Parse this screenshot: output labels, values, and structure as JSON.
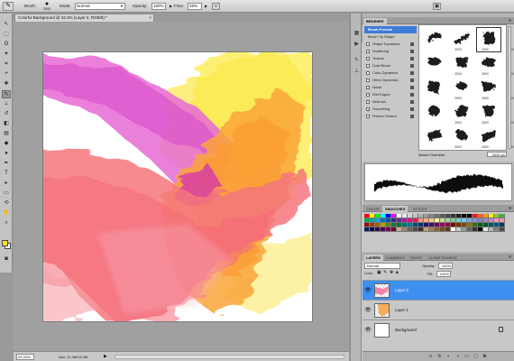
{
  "options_bar": {
    "brush_label": "Brush:",
    "brush_size": "2000",
    "mode_label": "Mode:",
    "mode_value": "Normal",
    "opacity_label": "Opacity:",
    "opacity_value": "100%",
    "flow_label": "Flow:",
    "flow_value": "49%"
  },
  "document": {
    "title": "Colorful Background @ 33.3% (Layer 2, RGB/8) *",
    "close": "×",
    "zoom": "33.33%",
    "doc_size": "Doc: 11.4M/15.0M"
  },
  "brushes_panel": {
    "tab": "BRUSHES",
    "presets_label": "Brush Presets",
    "options": [
      {
        "label": "Brush Tip Shape",
        "checkbox": false
      },
      {
        "label": "Shape Dynamics",
        "checkbox": true,
        "checked": false
      },
      {
        "label": "Scattering",
        "checkbox": true,
        "checked": false
      },
      {
        "label": "Texture",
        "checkbox": true,
        "checked": false
      },
      {
        "label": "Dual Brush",
        "checkbox": true,
        "checked": false
      },
      {
        "label": "Color Dynamics",
        "checkbox": true,
        "checked": false
      },
      {
        "label": "Other Dynamics",
        "checkbox": true,
        "checked": false
      },
      {
        "label": "Noise",
        "checkbox": true,
        "checked": false
      },
      {
        "label": "Wet Edges",
        "checkbox": true,
        "checked": false
      },
      {
        "label": "Airbrush",
        "checkbox": true,
        "checked": false
      },
      {
        "label": "Smoothing",
        "checkbox": true,
        "checked": true
      },
      {
        "label": "Protect Texture",
        "checkbox": true,
        "checked": false
      }
    ],
    "preset_sizes": [
      "2000",
      "2000",
      "2500",
      "2500",
      "2500",
      "2500",
      "2500",
      "2500",
      "2500",
      "2500",
      "2500",
      "2500",
      "2500",
      "2500",
      "2500"
    ],
    "master_diameter_label": "Master Diameter",
    "master_diameter_value": "2000 px"
  },
  "swatches_panel": {
    "tabs": [
      "COLOR",
      "SWATCHES",
      "STYLES"
    ],
    "active_tab": "SWATCHES",
    "colors": [
      "#ff0000",
      "#ffff00",
      "#00ff00",
      "#00ffff",
      "#0000ff",
      "#ff00ff",
      "#ffffff",
      "#ebebeb",
      "#d6d6d6",
      "#c2c2c2",
      "#adadad",
      "#999999",
      "#858585",
      "#707070",
      "#5c5c5c",
      "#474747",
      "#333333",
      "#1f1f1f",
      "#0a0a0a",
      "#000000",
      "#ed1c24",
      "#f26522",
      "#f7941d",
      "#fff200",
      "#8dc63f",
      "#39b54a",
      "#00a651",
      "#00a99d",
      "#00aeef",
      "#0072bc",
      "#0054a6",
      "#2e3192",
      "#662d91",
      "#92278f",
      "#ec008c",
      "#ed145b",
      "#f69679",
      "#f9ad81",
      "#fdc68a",
      "#fff79a",
      "#c4df9b",
      "#a3d39c",
      "#82ca9c",
      "#7accc8",
      "#6dcff6",
      "#7da7d9",
      "#8393ca",
      "#8781bd",
      "#a186be",
      "#bd8cbf",
      "#f49ac2",
      "#f6989d",
      "#9e0b0f",
      "#a0410d",
      "#a36209",
      "#aba000",
      "#598527",
      "#1a7b30",
      "#007236",
      "#00746b",
      "#0076a3",
      "#004b80",
      "#003471",
      "#1b1464",
      "#440e62",
      "#630460",
      "#9e005d",
      "#9e0039",
      "#790000",
      "#7b2e00",
      "#7d4900",
      "#827b00",
      "#406618",
      "#005e20",
      "#005826",
      "#005952",
      "#005b7f",
      "#003663",
      "#002157",
      "#0d004c",
      "#32004b",
      "#4b0049",
      "#7b0046",
      "#7a0026",
      "#c7b299",
      "#998675",
      "#736357",
      "#534741",
      "#37302d",
      "#c69c6d",
      "#a67c52",
      "#8c6239",
      "#754c24",
      "#603913",
      "#ffffff",
      "#cccccc",
      "#999999",
      "#666666",
      "#333333",
      "#000000",
      "#e6e6e6",
      "#b3b3b3",
      "#808080",
      "#4d4d4d"
    ]
  },
  "layers_panel": {
    "tabs": [
      "LAYERS",
      "CHANNELS",
      "PATHS",
      "CLONE SOURCE"
    ],
    "active_tab": "LAYERS",
    "blend_mode": "Normal",
    "opacity_label": "Opacity:",
    "opacity_value": "100%",
    "lock_label": "Lock:",
    "fill_label": "Fill:",
    "fill_value": "100%",
    "layers": [
      {
        "name": "Layer 2",
        "selected": true,
        "thumb": "pink-strokes"
      },
      {
        "name": "Layer 1",
        "selected": false,
        "thumb": "orange-strokes"
      },
      {
        "name": "Background",
        "selected": false,
        "thumb": "white",
        "locked": true
      }
    ]
  },
  "icons": {
    "eye": "eye-icon",
    "lock": "lock-icon",
    "panel_menu": "panel-menu-icon"
  },
  "accent_color": "#3d8ff0",
  "foreground_color": "#f5e51a",
  "background_color": "#ffffff"
}
